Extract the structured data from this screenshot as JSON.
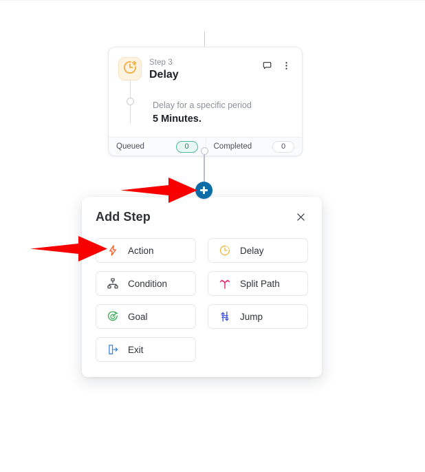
{
  "canvas": {
    "background": "#ffffff",
    "connector_color": "#c9ccd1"
  },
  "step_card": {
    "kicker": "Step 3",
    "title": "Delay",
    "icon": "clock-dashed-icon",
    "icon_tile_bg": "#fdf3e0",
    "icon_color": "#f0a93b",
    "detail": {
      "subtitle": "Delay for a specific period",
      "value": "5 Minutes."
    },
    "header_actions": [
      {
        "name": "comment-icon",
        "glyph": "speech-bubble"
      },
      {
        "name": "more-options-icon",
        "glyph": "vertical-ellipsis"
      }
    ],
    "footer": [
      {
        "label": "Queued",
        "count": "0",
        "style": "queued",
        "border_color": "#4fb6a0",
        "bg": "#e7f7f1"
      },
      {
        "label": "Completed",
        "count": "0",
        "style": "completed",
        "border_color": "#dfe2e6",
        "bg": "#ffffff"
      }
    ]
  },
  "add_button": {
    "name": "add-step-plus-button",
    "color": "#0b6ca8",
    "label": "+"
  },
  "add_panel": {
    "title": "Add Step",
    "close_label": "×",
    "options": [
      {
        "label": "Action",
        "icon": "lightning-bolt-icon",
        "color": "#f05a28"
      },
      {
        "label": "Delay",
        "icon": "clock-dashed-icon",
        "color": "#f0b23b"
      },
      {
        "label": "Condition",
        "icon": "sitemap-icon",
        "color": "#3c4149"
      },
      {
        "label": "Split Path",
        "icon": "split-path-icon",
        "color": "#e8246b"
      },
      {
        "label": "Goal",
        "icon": "goal-target-icon",
        "color": "#35a853"
      },
      {
        "label": "Jump",
        "icon": "jump-arrows-icon",
        "color": "#4558e0"
      },
      {
        "label": "Exit",
        "icon": "exit-door-icon",
        "color": "#3b82d6"
      }
    ]
  },
  "annotations": {
    "color": "#f80000",
    "arrows": [
      {
        "name": "arrow-pointing-to-plus-button",
        "target": "add-step-plus-button"
      },
      {
        "name": "arrow-pointing-to-action-option",
        "target": "option-action"
      }
    ]
  }
}
